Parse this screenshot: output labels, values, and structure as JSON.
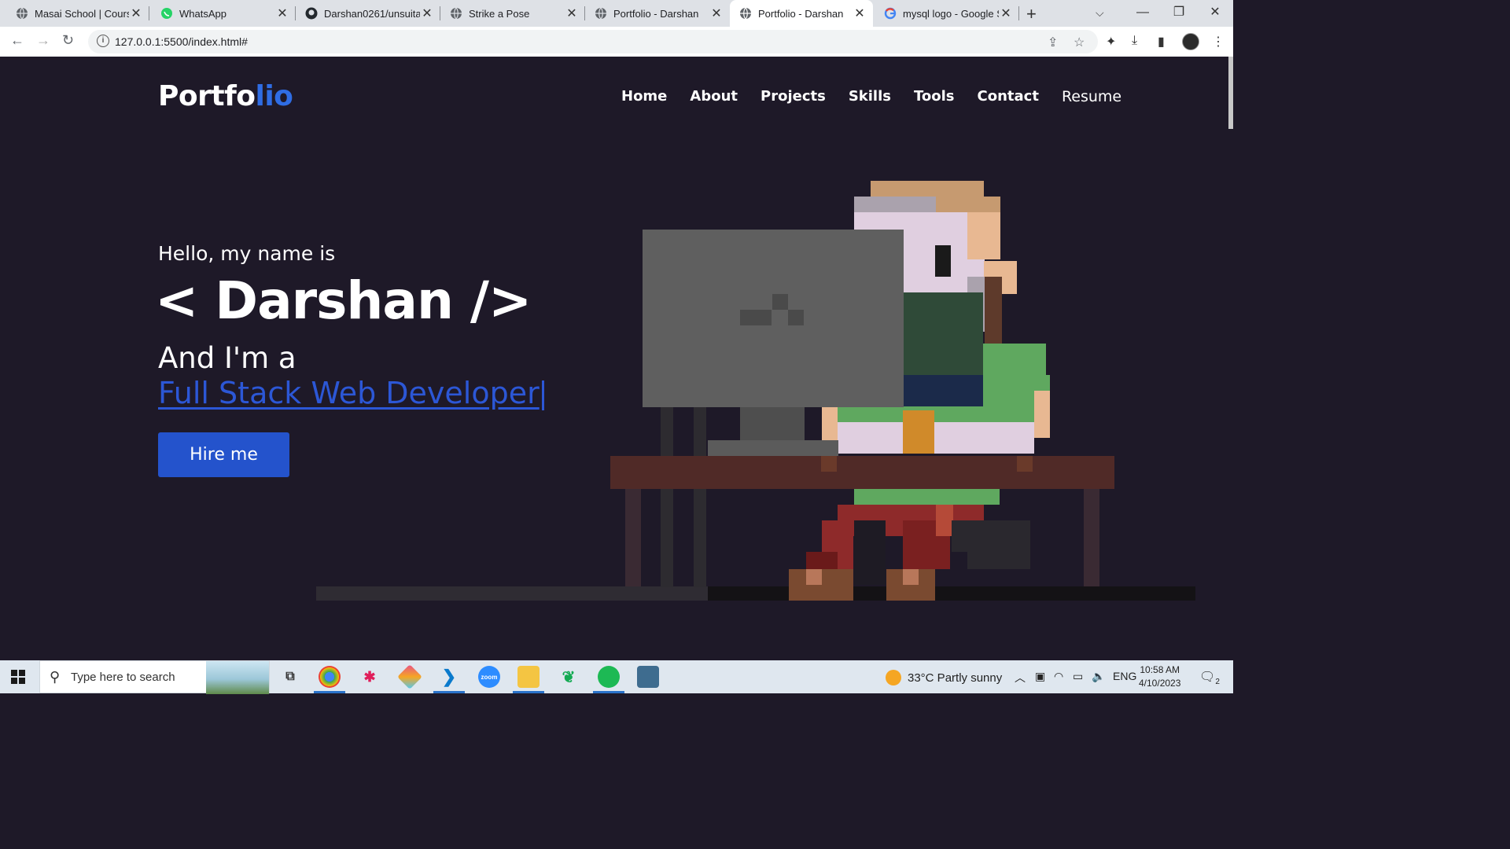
{
  "browser": {
    "tabs": [
      {
        "title": "Masai School | Course",
        "icon": "globe-icon"
      },
      {
        "title": "WhatsApp",
        "icon": "whatsapp-icon"
      },
      {
        "title": "Darshan0261/unsuita",
        "icon": "github-icon"
      },
      {
        "title": "Strike a Pose",
        "icon": "globe-icon"
      },
      {
        "title": "Portfolio - Darshan",
        "icon": "globe-icon"
      },
      {
        "title": "Portfolio - Darshan",
        "icon": "globe-icon",
        "active": true
      },
      {
        "title": "mysql logo - Google S",
        "icon": "google-icon"
      }
    ],
    "url": "127.0.0.1:5500/index.html#"
  },
  "site": {
    "logo_main": "Portfo",
    "logo_accent": "lio",
    "nav": [
      "Home",
      "About",
      "Projects",
      "Skills",
      "Tools",
      "Contact",
      "Resume"
    ],
    "hello": "Hello, my name is",
    "name": "< Darshan />",
    "intro": "And I'm a",
    "role": "Full Stack Web Developer",
    "hire_button": "Hire me",
    "accent_color": "#2453cc",
    "background_color": "#1e1928"
  },
  "taskbar": {
    "search_placeholder": "Type here to search",
    "apps": [
      "task-view-icon",
      "chrome-icon",
      "slack-icon",
      "git-icon",
      "vscode-icon",
      "zoom-icon",
      "file-explorer-icon",
      "mongodb-icon",
      "spotify-icon",
      "mysql-workbench-icon"
    ],
    "weather": "33°C  Partly sunny",
    "language": "ENG",
    "time": "10:58 AM",
    "date": "4/10/2023",
    "notifications": "2"
  }
}
